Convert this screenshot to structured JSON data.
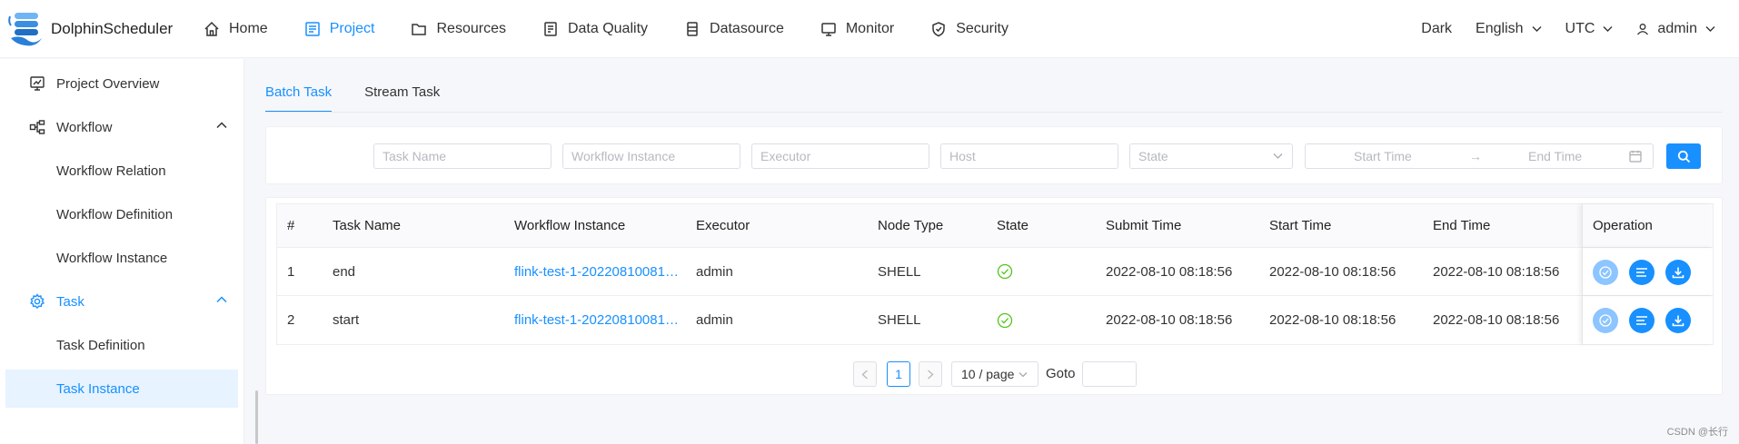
{
  "app": {
    "name": "DolphinScheduler"
  },
  "nav": {
    "items": [
      {
        "label": "Home",
        "icon": "home-icon"
      },
      {
        "label": "Project",
        "icon": "project-icon",
        "active": true
      },
      {
        "label": "Resources",
        "icon": "folder-icon"
      },
      {
        "label": "Data Quality",
        "icon": "data-quality-icon"
      },
      {
        "label": "Datasource",
        "icon": "datasource-icon"
      },
      {
        "label": "Monitor",
        "icon": "monitor-icon"
      },
      {
        "label": "Security",
        "icon": "shield-icon"
      }
    ]
  },
  "header_right": {
    "theme": "Dark",
    "language": "English",
    "timezone": "UTC",
    "user": "admin"
  },
  "sidebar": {
    "items": [
      {
        "label": "Project Overview",
        "icon": "chart-board-icon"
      },
      {
        "label": "Workflow",
        "icon": "workflow-icon",
        "expanded": true
      },
      {
        "label": "Workflow Relation"
      },
      {
        "label": "Workflow Definition"
      },
      {
        "label": "Workflow Instance"
      },
      {
        "label": "Task",
        "icon": "gear-icon",
        "expanded": true
      },
      {
        "label": "Task Definition"
      },
      {
        "label": "Task Instance",
        "selected": true
      }
    ]
  },
  "tabs": [
    {
      "label": "Batch Task",
      "active": true
    },
    {
      "label": "Stream Task"
    }
  ],
  "filters": {
    "task_name_placeholder": "Task Name",
    "workflow_instance_placeholder": "Workflow Instance",
    "executor_placeholder": "Executor",
    "host_placeholder": "Host",
    "state_placeholder": "State",
    "start_time_placeholder": "Start Time",
    "end_time_placeholder": "End Time",
    "range_separator": "→"
  },
  "table": {
    "headers": [
      "#",
      "Task Name",
      "Workflow Instance",
      "Executor",
      "Node Type",
      "State",
      "Submit Time",
      "Start Time",
      "End Time",
      "Operation"
    ],
    "rows": [
      {
        "index": "1",
        "task_name": "end",
        "workflow_instance": "flink-test-1-20220810081…",
        "executor": "admin",
        "node_type": "SHELL",
        "state": "success",
        "submit_time": "2022-08-10 08:18:56",
        "start_time": "2022-08-10 08:18:56",
        "end_time": "2022-08-10 08:18:56"
      },
      {
        "index": "2",
        "task_name": "start",
        "workflow_instance": "flink-test-1-20220810081…",
        "executor": "admin",
        "node_type": "SHELL",
        "state": "success",
        "submit_time": "2022-08-10 08:18:56",
        "start_time": "2022-08-10 08:18:56",
        "end_time": "2022-08-10 08:18:56"
      }
    ]
  },
  "pagination": {
    "current_page": "1",
    "page_size": "10 / page",
    "goto_label": "Goto",
    "goto_value": ""
  },
  "colors": {
    "accent": "#1890ff",
    "success": "#52c41a",
    "disabled_button": "#8cc5ff"
  },
  "watermark": "CSDN @长行"
}
